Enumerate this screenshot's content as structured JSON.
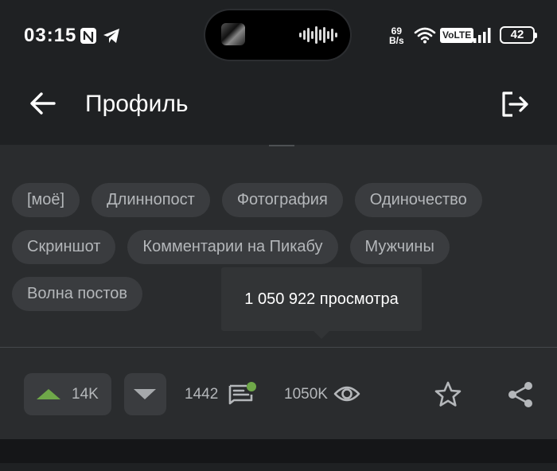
{
  "status_bar": {
    "time": "03:15",
    "net_speed_value": "69",
    "net_speed_unit": "B/s",
    "volte": "VoLTE",
    "battery": "42"
  },
  "header": {
    "title": "Профиль"
  },
  "tags": [
    [
      "[моё]",
      "Длиннопост",
      "Фотография",
      "Одиночество"
    ],
    [
      "Скриншот",
      "Комментарии на Пикабу",
      "Мужчины"
    ],
    [
      "Волна постов"
    ]
  ],
  "tooltip": {
    "text": "1 050 922 просмотра"
  },
  "actions": {
    "rating": "14K",
    "comments": "1442",
    "views": "1050K"
  },
  "colors": {
    "background": "#1f2123",
    "content_background": "#2a2c2e",
    "tag_background": "#3a3c3f",
    "upvote_arrow": "#6fa849",
    "comment_badge": "#6fa849"
  },
  "icons": [
    "nfc-icon",
    "telegram-icon",
    "wifi-icon",
    "signal-icon",
    "back-arrow-icon",
    "logout-icon",
    "comment-icon",
    "eye-icon",
    "star-icon",
    "share-icon"
  ]
}
